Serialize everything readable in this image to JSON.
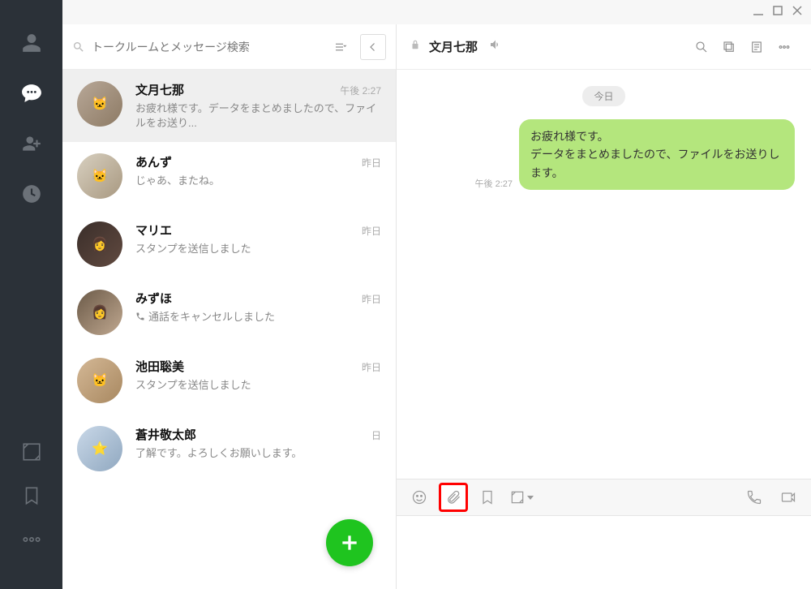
{
  "search": {
    "placeholder": "トークルームとメッセージ検索"
  },
  "chats": [
    {
      "name": "文月七那",
      "time": "午後 2:27",
      "preview": "お疲れ様です。データをまとめましたので、ファイルをお送り...",
      "icon": null
    },
    {
      "name": "あんず",
      "time": "昨日",
      "preview": "じゃあ、またね。",
      "icon": null
    },
    {
      "name": "マリエ",
      "time": "昨日",
      "preview": "スタンプを送信しました",
      "icon": null
    },
    {
      "name": "みずほ",
      "time": "昨日",
      "preview": "通話をキャンセルしました",
      "icon": "phone"
    },
    {
      "name": "池田聡美",
      "time": "昨日",
      "preview": "スタンプを送信しました",
      "icon": null
    },
    {
      "name": "蒼井敬太郎",
      "time": "日",
      "preview": "了解です。よろしくお願いします。",
      "icon": null
    }
  ],
  "pane": {
    "title": "文月七那",
    "date": "今日",
    "msgTime": "午後 2:27",
    "msgLine1": "お疲れ様です。",
    "msgLine2": "データをまとめましたので、ファイルをお送りします。"
  }
}
